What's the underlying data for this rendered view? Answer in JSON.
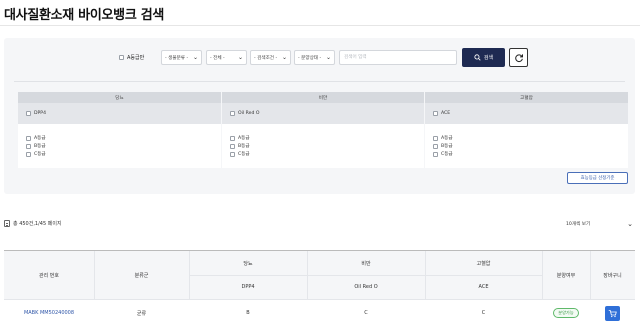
{
  "page": {
    "title": "대사질환소재 바이오뱅크 검색"
  },
  "filters": {
    "a_grade_label": "A등급만",
    "selects": [
      {
        "label": "- 생물분류 -"
      },
      {
        "label": "- 전체 -"
      },
      {
        "label": "- 검색조건 -"
      },
      {
        "label": "- 분양상태 -"
      }
    ],
    "search_placeholder": "검색어 입력",
    "search_value": "",
    "search_button": "검색",
    "search_icon": "search-icon",
    "refresh_icon": "refresh-icon"
  },
  "categories": [
    {
      "name": "당뇨",
      "marker": "DPP4",
      "grades": [
        "A등급",
        "B등급",
        "C등급"
      ]
    },
    {
      "name": "비만",
      "marker": "Oil Red O",
      "grades": [
        "A등급",
        "B등급",
        "C등급"
      ]
    },
    {
      "name": "고혈압",
      "marker": "ACE",
      "grades": [
        "A등급",
        "B등급",
        "C등급"
      ]
    }
  ],
  "criteria_button": "효능등급 선정기준",
  "results": {
    "summary": "총 450건,1/45 페이지",
    "page_size": "10개씩 보기",
    "headers": {
      "id": "관리 번호",
      "group": "분류군",
      "diabetes": "당뇨",
      "obesity": "비만",
      "hypertension": "고혈압",
      "diabetes_marker": "DPP4",
      "obesity_marker": "Oil Red O",
      "hypertension_marker": "ACE",
      "availability": "분양여부",
      "cart": "장바구니"
    },
    "rows": [
      {
        "id": "MABK MM50240008",
        "group": "균류",
        "dpp4": "B",
        "oil_red_o": "C",
        "ace": "C",
        "status": "분양가능"
      }
    ]
  },
  "colors": {
    "accent": "#1e2a52",
    "link": "#2f56a8",
    "status_green": "#3a9a46",
    "cart_blue": "#2f6fd8"
  }
}
